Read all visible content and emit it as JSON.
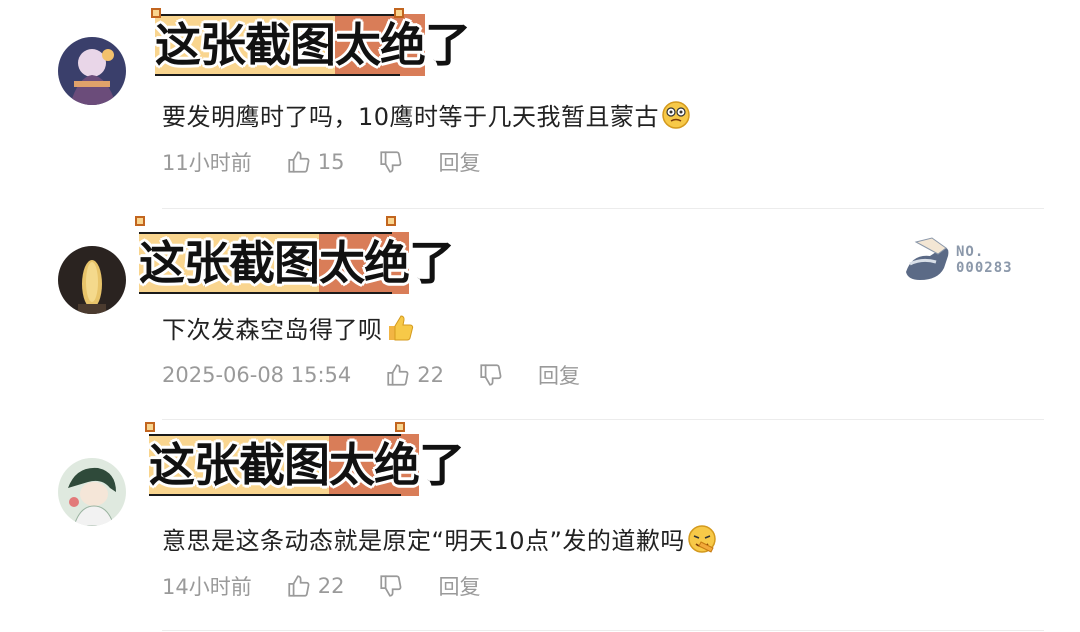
{
  "overlay_caption": {
    "part_a": "这张截图",
    "part_b": "太绝",
    "part_c": "了"
  },
  "comments": [
    {
      "text": "要发明鹰时了吗，10鹰时等于几天我暂且蒙古",
      "emoji": "dizzy-face-emoji",
      "time": "11小时前",
      "likes": "15",
      "reply_label": "回复"
    },
    {
      "text": "下次发森空岛得了呗",
      "emoji": "thumbs-up-emoji",
      "time": "2025-06-08 15:54",
      "likes": "22",
      "reply_label": "回复",
      "badge": {
        "label": "NO.",
        "number": "000283"
      }
    },
    {
      "text": "意思是这条动态就是原定“明天10点”发的道歉吗",
      "emoji": "facepalm-emoji",
      "time": "14小时前",
      "likes": "22",
      "reply_label": "回复"
    }
  ],
  "colors": {
    "banner_yellow": "#f9d58f",
    "banner_orange": "#d97d58",
    "meta_gray": "#9a9a9a",
    "badge_gray": "#8b98aa"
  }
}
